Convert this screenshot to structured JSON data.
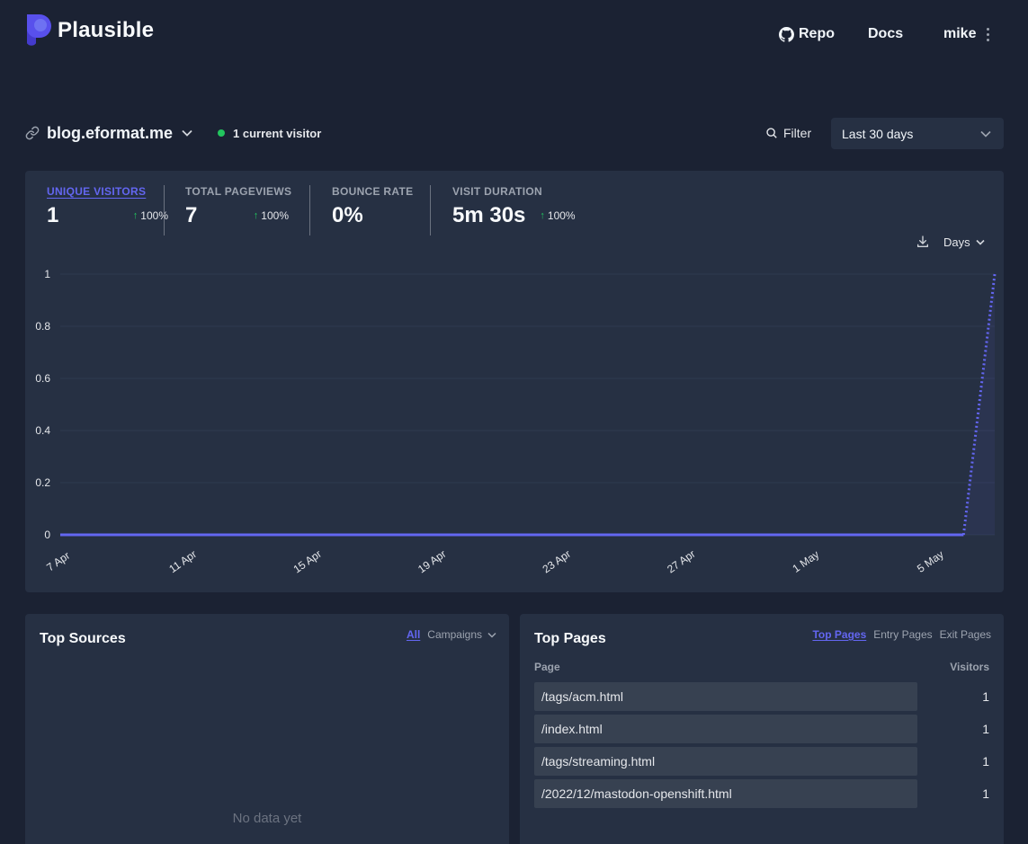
{
  "brand": {
    "name": "Plausible"
  },
  "nav": {
    "repo": "Repo",
    "docs": "Docs",
    "user": "mike"
  },
  "site": {
    "domain": "blog.eformat.me",
    "current_visitors": "1 current visitor"
  },
  "controls": {
    "filter": "Filter",
    "period": "Last 30 days",
    "interval": "Days"
  },
  "stats": [
    {
      "label": "UNIQUE VISITORS",
      "value": "1",
      "change": "100%"
    },
    {
      "label": "TOTAL PAGEVIEWS",
      "value": "7",
      "change": "100%"
    },
    {
      "label": "BOUNCE RATE",
      "value": "0%",
      "change": ""
    },
    {
      "label": "VISIT DURATION",
      "value": "5m 30s",
      "change": "100%"
    }
  ],
  "colors": {
    "accent": "#6366f1",
    "positive": "#22c55e",
    "background": "#1b2233",
    "card": "#263043",
    "bar": "#374151"
  },
  "chart_data": {
    "type": "line",
    "x": [
      "7 Apr",
      "8 Apr",
      "9 Apr",
      "10 Apr",
      "11 Apr",
      "12 Apr",
      "13 Apr",
      "14 Apr",
      "15 Apr",
      "16 Apr",
      "17 Apr",
      "18 Apr",
      "19 Apr",
      "20 Apr",
      "21 Apr",
      "22 Apr",
      "23 Apr",
      "24 Apr",
      "25 Apr",
      "26 Apr",
      "27 Apr",
      "28 Apr",
      "29 Apr",
      "30 Apr",
      "1 May",
      "2 May",
      "3 May",
      "4 May",
      "5 May",
      "6 May",
      "7 May"
    ],
    "series": [
      {
        "values": [
          0,
          0,
          0,
          0,
          0,
          0,
          0,
          0,
          0,
          0,
          0,
          0,
          0,
          0,
          0,
          0,
          0,
          0,
          0,
          0,
          0,
          0,
          0,
          0,
          0,
          0,
          0,
          0,
          0,
          0,
          1
        ]
      }
    ],
    "x_tick_labels": [
      "7 Apr",
      "11 Apr",
      "15 Apr",
      "19 Apr",
      "23 Apr",
      "27 Apr",
      "1 May",
      "5 May"
    ],
    "y_ticks": [
      0,
      0.2,
      0.4,
      0.6,
      0.8,
      1
    ],
    "ylim": [
      0,
      1
    ],
    "grid": true,
    "last_segment_dotted": true,
    "color": "#6366f1"
  },
  "top_sources": {
    "title": "Top Sources",
    "tabs": [
      "All",
      "Campaigns"
    ],
    "active_tab": "All",
    "empty": "No data yet"
  },
  "top_pages": {
    "title": "Top Pages",
    "tabs": [
      "Top Pages",
      "Entry Pages",
      "Exit Pages"
    ],
    "active_tab": "Top Pages",
    "col_page": "Page",
    "col_visitors": "Visitors",
    "rows": [
      {
        "page": "/tags/acm.html",
        "visitors": "1"
      },
      {
        "page": "/index.html",
        "visitors": "1"
      },
      {
        "page": "/tags/streaming.html",
        "visitors": "1"
      },
      {
        "page": "/2022/12/mastodon-openshift.html",
        "visitors": "1"
      }
    ]
  }
}
